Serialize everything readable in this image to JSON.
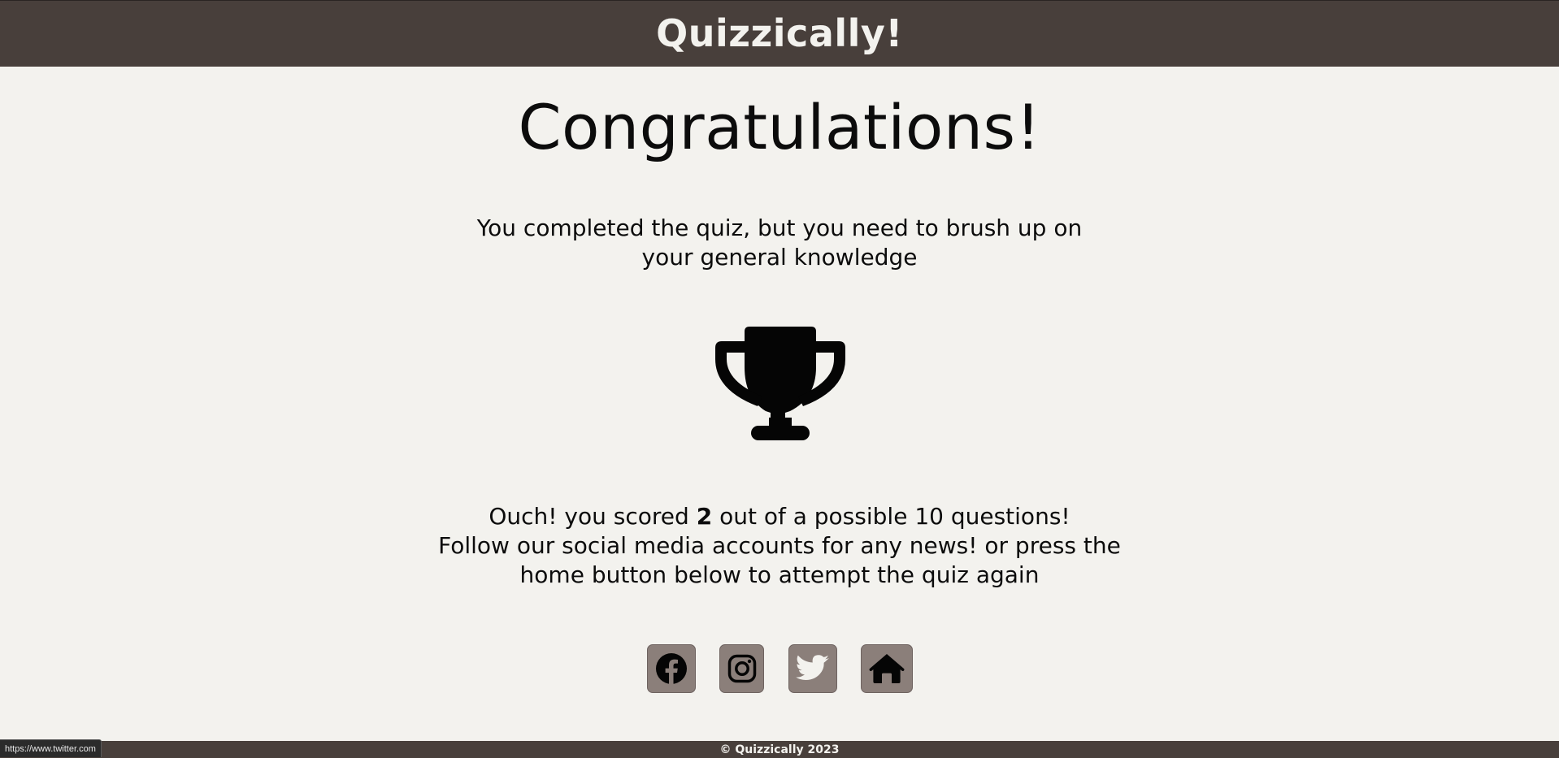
{
  "header": {
    "title": "Quizzically!"
  },
  "main": {
    "heading": "Congratulations!",
    "completed_message": "You completed the quiz, but you need to brush up on your general knowledge",
    "trophy_icon": "trophy-icon",
    "score": {
      "prefix": "Ouch! you scored ",
      "value": "2",
      "suffix": " out of a possible 10 questions!",
      "follow_text": "Follow our social media accounts for any news! or press the home button below to attempt the quiz again"
    }
  },
  "social_links": [
    {
      "name": "facebook",
      "icon": "facebook-icon"
    },
    {
      "name": "instagram",
      "icon": "instagram-icon"
    },
    {
      "name": "twitter",
      "icon": "twitter-icon"
    },
    {
      "name": "home",
      "icon": "home-icon"
    }
  ],
  "colors": {
    "header_bg": "#483f3b",
    "page_bg": "#f3f2ee",
    "button_bg": "#8b7f7a",
    "text": "#0c0c0c"
  },
  "footer": {
    "copyright": "© Quizzically 2023"
  },
  "browser_status": {
    "url": "https://www.twitter.com"
  }
}
